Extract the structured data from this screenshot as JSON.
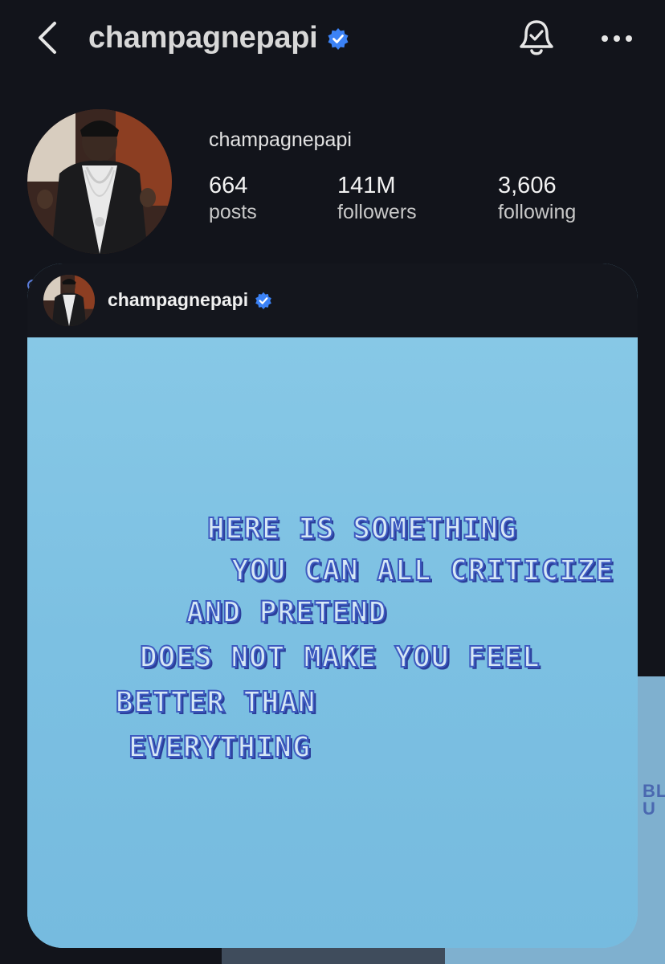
{
  "header": {
    "title": "champagnepapi"
  },
  "profile": {
    "username": "champagnepapi",
    "stats": [
      {
        "value": "664",
        "label": "posts"
      },
      {
        "value": "141M",
        "label": "followers"
      },
      {
        "value": "3,606",
        "label": "following"
      }
    ]
  },
  "post": {
    "username": "champagnepapi",
    "quote_lines": [
      "HERE IS SOMETHING",
      "YOU CAN ALL CRITICIZE",
      "AND PRETEND",
      "DOES NOT MAKE YOU FEEL",
      "BETTER THAN",
      "EVERYTHING"
    ]
  },
  "background_tile": {
    "peek_text": "BL\nU"
  },
  "colors": {
    "background": "#12141b",
    "verified_badge": "#3b82f6",
    "post_image": "#7ec2e3",
    "quote_outline": "#3d5ac0"
  },
  "icons": [
    "chevron-left-icon",
    "verified-badge-icon",
    "bell-icon",
    "more-horizontal-icon"
  ]
}
